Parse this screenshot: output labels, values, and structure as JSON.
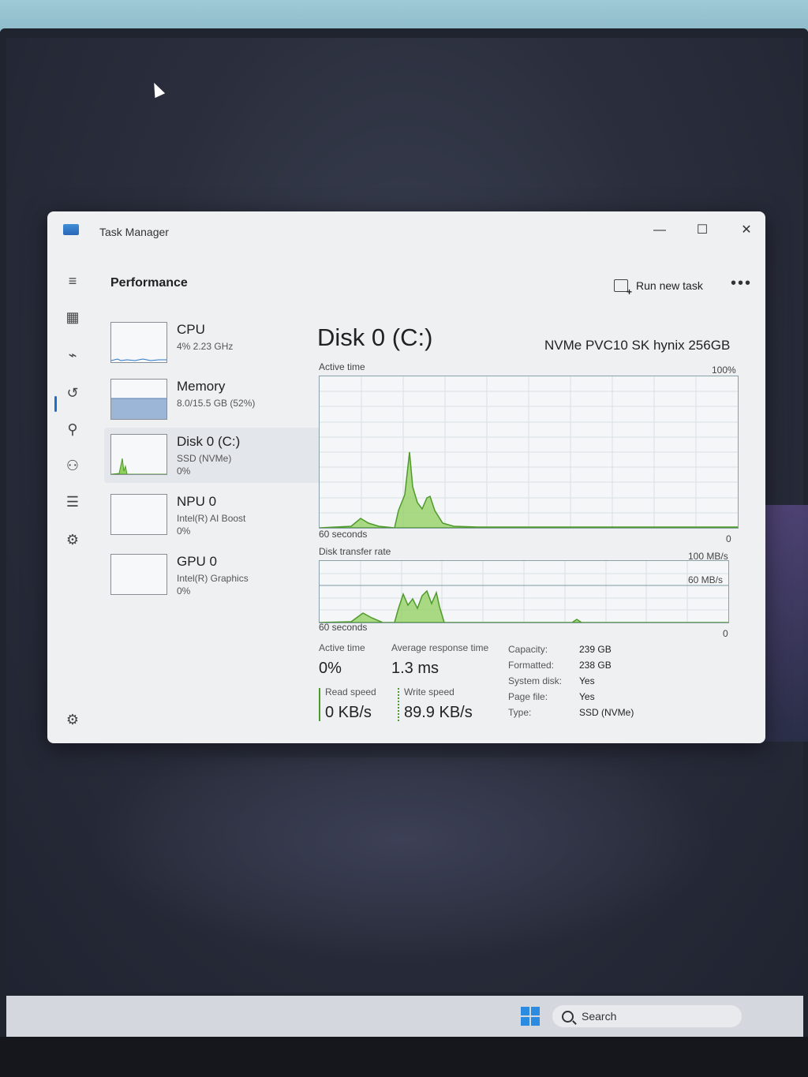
{
  "window": {
    "title": "Task Manager",
    "minimize": "—",
    "maximize": "☐",
    "close": "✕"
  },
  "header": {
    "title": "Performance",
    "run_new_task": "Run new task",
    "more": "•••"
  },
  "devices": [
    {
      "name": "CPU",
      "line2": "4% 2.23 GHz",
      "line3": ""
    },
    {
      "name": "Memory",
      "line2": "8.0/15.5 GB (52%)",
      "line3": ""
    },
    {
      "name": "Disk 0 (C:)",
      "line2": "SSD (NVMe)",
      "line3": "0%"
    },
    {
      "name": "NPU 0",
      "line2": "Intel(R) AI Boost",
      "line3": "0%"
    },
    {
      "name": "GPU 0",
      "line2": "Intel(R) Graphics",
      "line3": "0%"
    }
  ],
  "disk": {
    "title": "Disk 0 (C:)",
    "model": "NVMe PVC10 SK hynix 256GB",
    "chart1": {
      "label": "Active time",
      "max": "100%",
      "min": "0",
      "duration": "60 seconds"
    },
    "chart2": {
      "label": "Disk transfer rate",
      "max": "100 MB/s",
      "mid": "60 MB/s",
      "min": "0",
      "duration": "60 seconds"
    },
    "stats": {
      "active_time_label": "Active time",
      "active_time": "0%",
      "avg_response_label": "Average response time",
      "avg_response": "1.3 ms",
      "read_label": "Read speed",
      "read": "0 KB/s",
      "write_label": "Write speed",
      "write": "89.9 KB/s"
    },
    "props": [
      {
        "label": "Capacity:",
        "value": "239 GB"
      },
      {
        "label": "Formatted:",
        "value": "238 GB"
      },
      {
        "label": "System disk:",
        "value": "Yes"
      },
      {
        "label": "Page file:",
        "value": "Yes"
      },
      {
        "label": "Type:",
        "value": "SSD (NVMe)"
      }
    ]
  },
  "taskbar": {
    "search": "Search"
  },
  "colors": {
    "graph_line": "#4f9a2c",
    "graph_fill": "#8fcf5c",
    "accent": "#1f6fc8"
  }
}
